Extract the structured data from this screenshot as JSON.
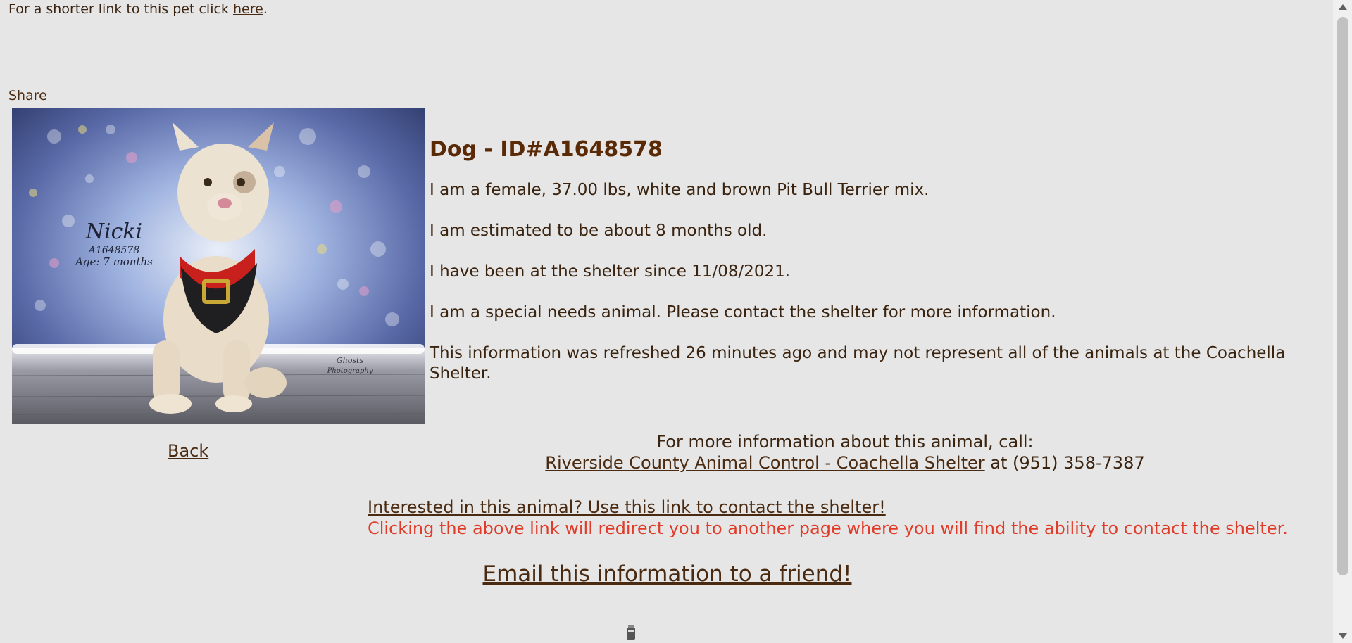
{
  "header": {
    "shorter_link_prefix": "For a shorter link to this pet click ",
    "shorter_link_text": "here",
    "shorter_link_suffix": "."
  },
  "share_label": "Share",
  "photo": {
    "name_text": "Nicki",
    "id_text": "A1648578",
    "age_text": "Age: 7 months",
    "credit_line1": "Ghosts",
    "credit_line2": "Photography"
  },
  "back_label": "Back",
  "animal": {
    "title": "Dog - ID#A1648578",
    "desc": "I am a female, 37.00 lbs, white and brown Pit Bull Terrier mix.",
    "age": "I am estimated to be about 8 months old.",
    "since": "I have been at the shelter since 11/08/2021.",
    "special": "I am a special needs animal. Please contact the shelter for more information.",
    "refresh": "This information was refreshed 26 minutes ago and may not represent all of the animals at the Coachella Shelter."
  },
  "contact": {
    "call_line": "For more information about this animal, call:",
    "shelter_name": "Riverside County Animal Control - Coachella Shelter",
    "phone_text": " at (951) 358-7387"
  },
  "interest": {
    "link": "Interested in this animal? Use this link to contact the shelter!",
    "warning": "Clicking the above link will redirect you to another page where you will find the ability to contact the shelter."
  },
  "email_label": "Email this information to a friend!",
  "colors": {
    "background": "#e6e6e6",
    "text": "#4a2a10",
    "warning": "#e03c2a"
  }
}
